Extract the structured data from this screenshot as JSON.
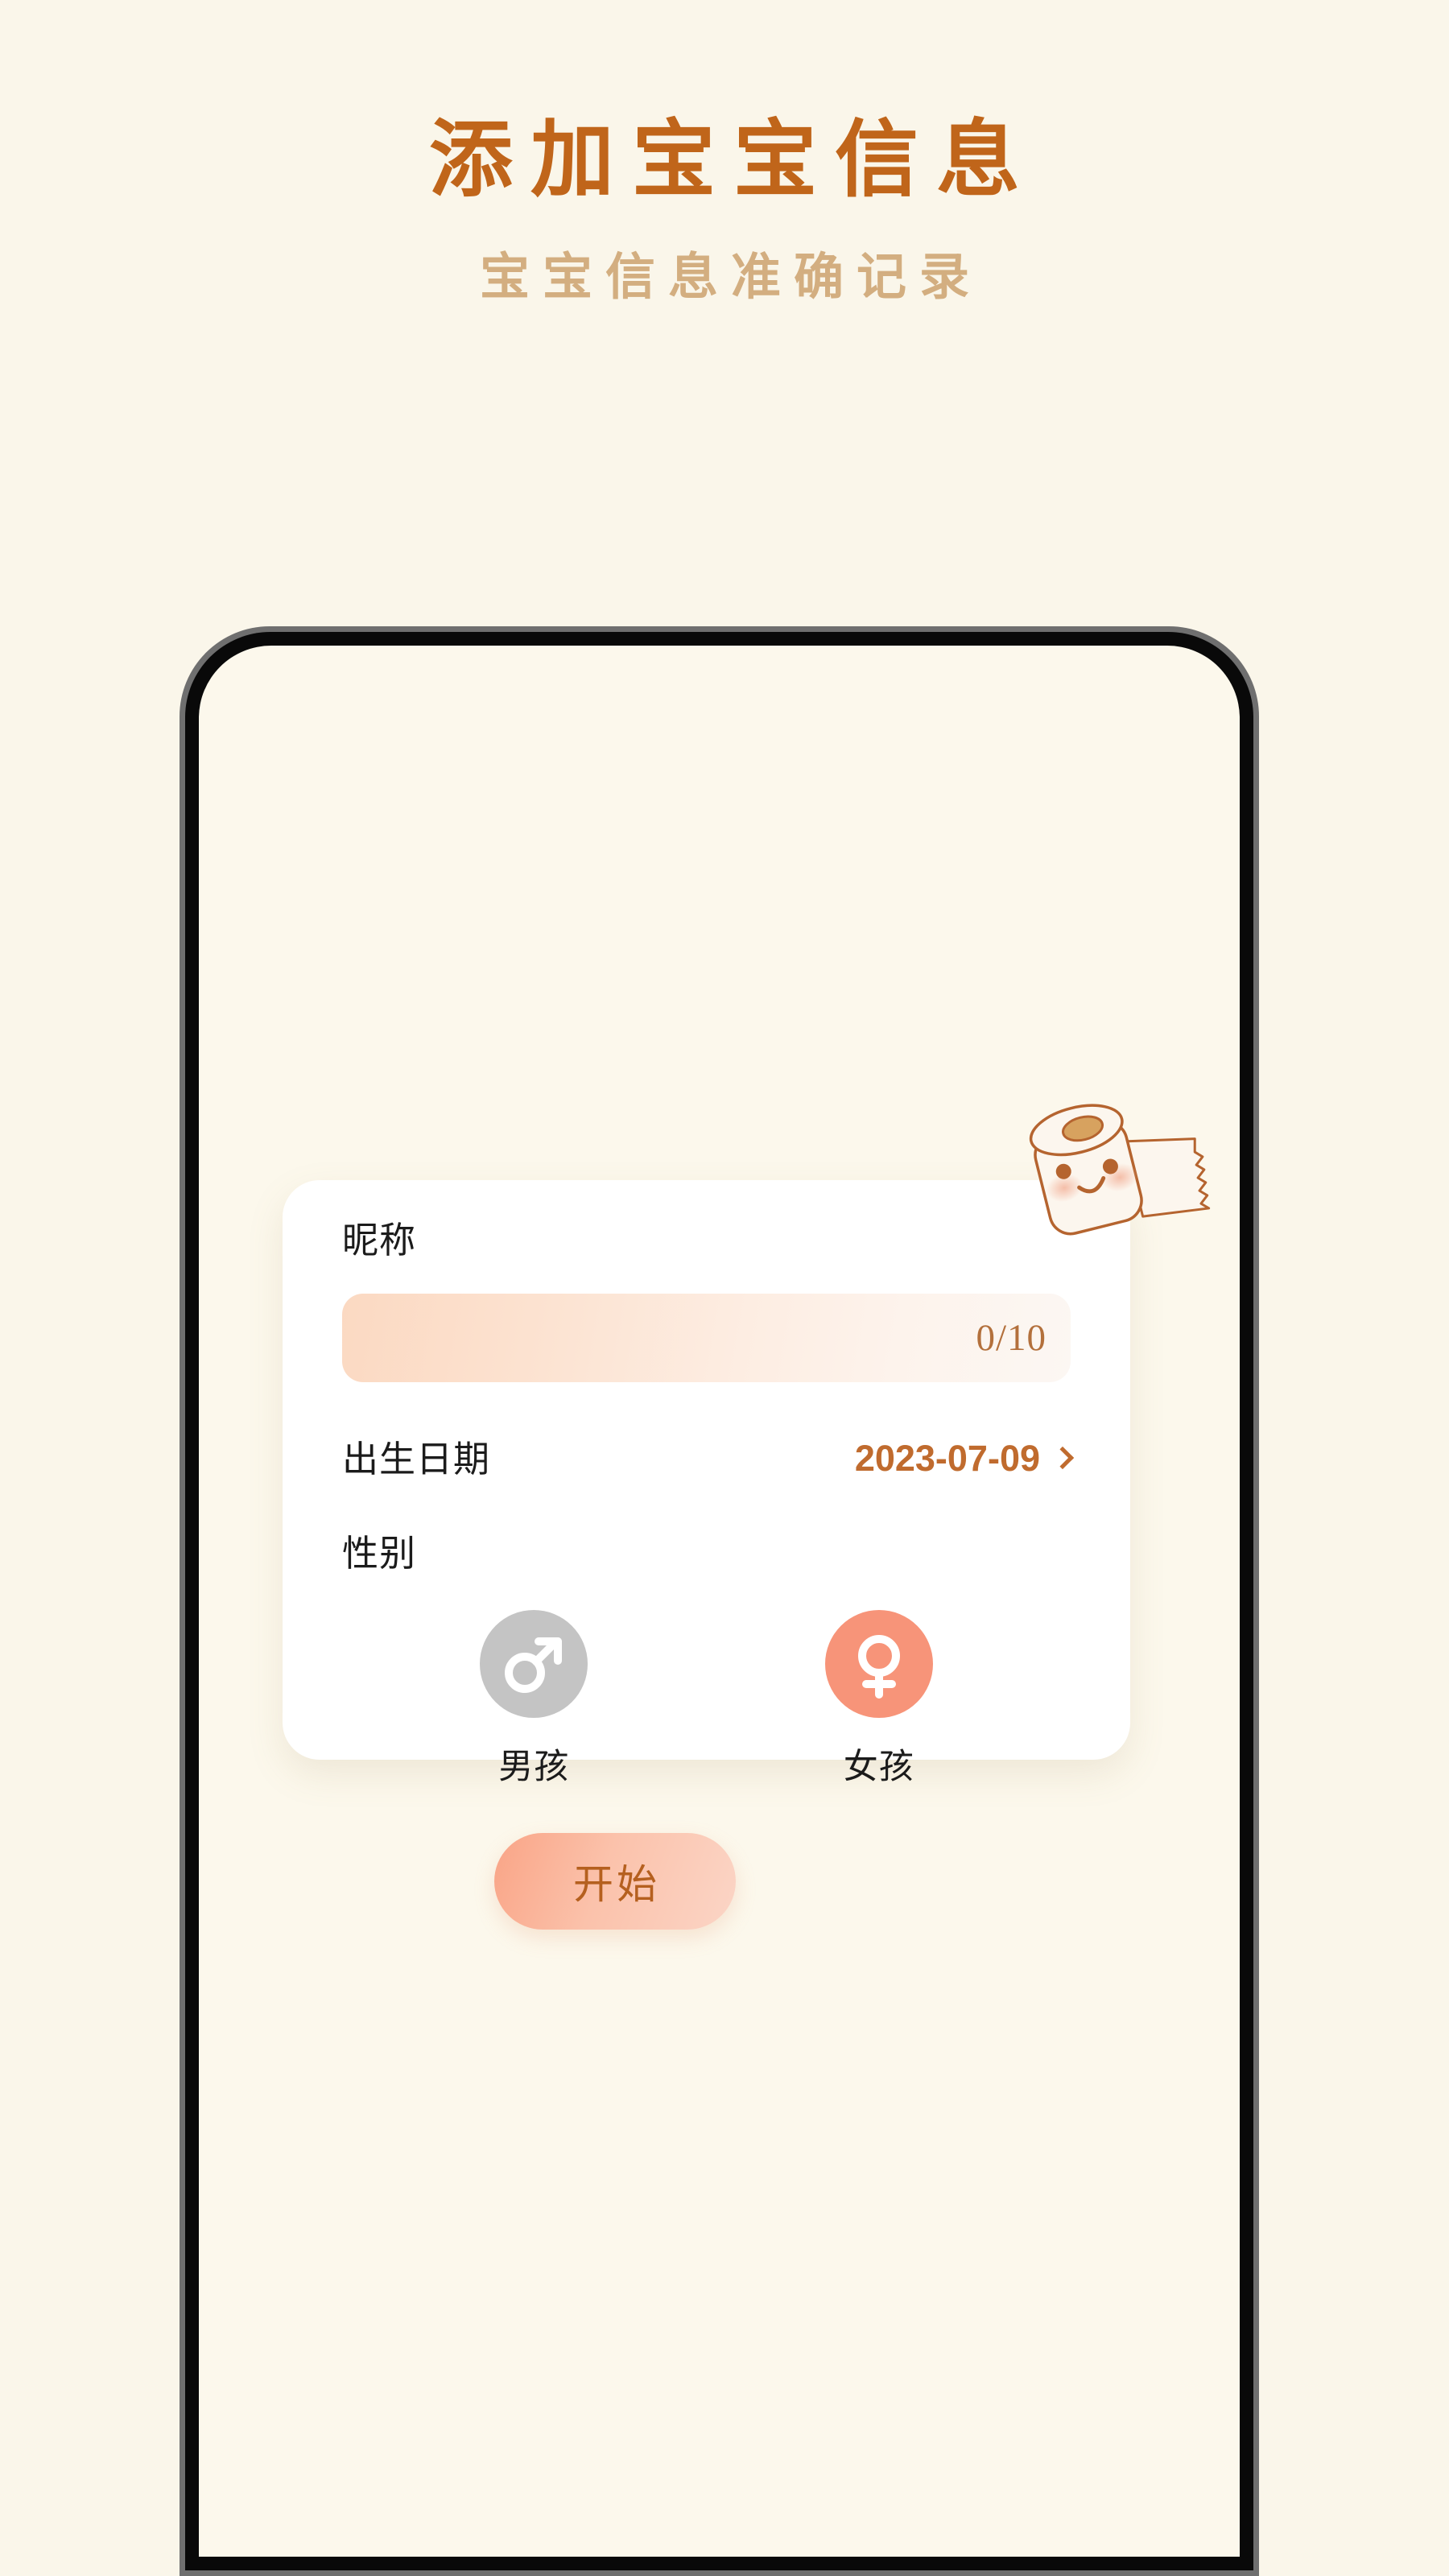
{
  "header": {
    "title": "添加宝宝信息",
    "subtitle": "宝宝信息准确记录"
  },
  "colors": {
    "page_background": "#FAF6EA",
    "screen_background": "#FCF8EC",
    "title_color": "#C0651A",
    "subtitle_color": "#D3AE80",
    "accent_orange": "#C06B2E",
    "counter_color": "#B3703C",
    "girl_selected": "#F79479",
    "boy_unselected": "#C4C4C4",
    "card_background": "#FFFFFF",
    "button_text": "#B5601F"
  },
  "card": {
    "nickname": {
      "label": "昵称",
      "value": "",
      "placeholder": "",
      "counter": "0/10",
      "max_length": 10
    },
    "birthdate": {
      "label": "出生日期",
      "value": "2023-07-09",
      "chevron_icon": "chevron-right-icon"
    },
    "gender": {
      "label": "性别",
      "options": [
        {
          "key": "boy",
          "label": "男孩",
          "icon": "male-symbol-icon",
          "selected": false
        },
        {
          "key": "girl",
          "label": "女孩",
          "icon": "female-symbol-icon",
          "selected": true
        }
      ]
    }
  },
  "start_button": {
    "label": "开始"
  },
  "mascot": {
    "name": "toilet-paper-roll-mascot"
  }
}
